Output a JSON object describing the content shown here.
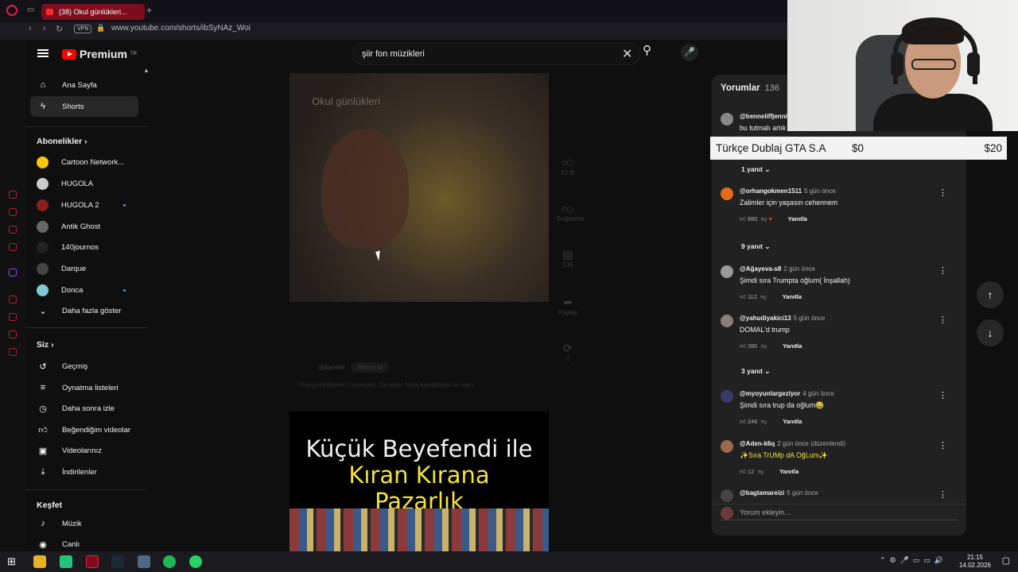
{
  "browser": {
    "tab_title": "(38) Okul günlükleri...",
    "url": "www.youtube.com/shorts/ibSyNAz_Woi",
    "vpn_label": "VPN"
  },
  "header": {
    "brand": "Premium",
    "brand_region": "TR",
    "search_value": "şiir fon müzikleri"
  },
  "sidebar": {
    "main": [
      {
        "label": "Ana Sayfa",
        "icon": "home-icon"
      },
      {
        "label": "Shorts",
        "icon": "shorts-icon",
        "active": true
      }
    ],
    "subs_title": "Abonelikler",
    "subs": [
      {
        "label": "Cartoon Network...",
        "color": "#f5c800"
      },
      {
        "label": "HUGOLA",
        "color": "#cccccc"
      },
      {
        "label": "HUGOLA 2",
        "color": "#8a1c1c"
      },
      {
        "label": "Antik Ghost",
        "color": "#666666"
      },
      {
        "label": "140journos",
        "color": "#222222"
      },
      {
        "label": "Darque",
        "color": "#444444"
      },
      {
        "label": "Donca",
        "color": "#7fc8d8"
      }
    ],
    "show_more": "Daha fazla göster",
    "you_title": "Siz",
    "you": [
      {
        "label": "Geçmiş",
        "icon": "history-icon"
      },
      {
        "label": "Oynatma listeleri",
        "icon": "playlist-icon"
      },
      {
        "label": "Daha sonra izle",
        "icon": "clock-icon"
      },
      {
        "label": "Beğendiğim videolar",
        "icon": "like-icon"
      },
      {
        "label": "Videolarınız",
        "icon": "video-icon"
      },
      {
        "label": "İndirilenler",
        "icon": "download-icon"
      }
    ],
    "explore_title": "Keşfet",
    "explore": [
      {
        "label": "Müzik",
        "icon": "music-icon"
      },
      {
        "label": "Canlı",
        "icon": "live-icon"
      }
    ]
  },
  "short": {
    "overlay_title": "Okul günlükleri",
    "channel": "@kanekil",
    "subscribe": "Abone ol",
    "description": "Okul günlüklerini izlemeyinz. Bu sefer farklı karakterler de var.)",
    "side_like": "61 B",
    "side_dislike": "Beğenme",
    "side_comments": "136",
    "side_share": "Paylaş",
    "side_remix": "2"
  },
  "next_short": {
    "line1": "Küçük Beyefendi ile",
    "line2": "Kıran Kırana",
    "line3": "Pazarlık"
  },
  "comments": {
    "title": "Yorumlar",
    "count": "136",
    "items": [
      {
        "user": "@benneliffjenni...",
        "time": "",
        "text": "bu tutmalı artık",
        "avatar": "#888888"
      },
      {
        "replies": "1 yanıt"
      },
      {
        "user": "@orhangokmen1511",
        "time": "5 gün önce",
        "text": "Zalimler için yaşasın cehennem",
        "likes": "880",
        "avatar": "#e46a1a"
      },
      {
        "replies": "9 yanıt"
      },
      {
        "user": "@Ağayeva-s8",
        "time": "2 gün önce",
        "text": "Şimdi sıra Trumpta oğlum( İnşallah)",
        "likes": "112",
        "avatar": "#999999"
      },
      {
        "user": "@yahudiyakici13",
        "time": "5 gün önce",
        "text": "DOMAL'd trump",
        "likes": "280",
        "avatar": "#8c7d70"
      },
      {
        "replies": "3 yanıt"
      },
      {
        "user": "@myoyunlargeziyor",
        "time": "4 gün önce",
        "text": "Şimdi sıra trup da oğlum😂",
        "likes": "246",
        "avatar": "#3a3a6a"
      },
      {
        "user": "@Aden-k6q",
        "time": "2 gün önce (düzenlendi)",
        "text": "✨Sıra TrUMp dA OğLum✨",
        "likes": "12",
        "avatar": "#9a6a4a"
      },
      {
        "user": "@baglamareizi",
        "time": "5 gün önce",
        "text": "",
        "avatar": "#444444"
      }
    ],
    "reply_label": "Yanıtla",
    "add_placeholder": "Yorum ekleyin..."
  },
  "donation": {
    "name": "Türkçe Dublaj GTA S.A",
    "current": "$0",
    "goal": "$20",
    "progress_fraction": 0
  },
  "taskbar": {
    "time": "21:15",
    "date": "14.02.2026"
  }
}
